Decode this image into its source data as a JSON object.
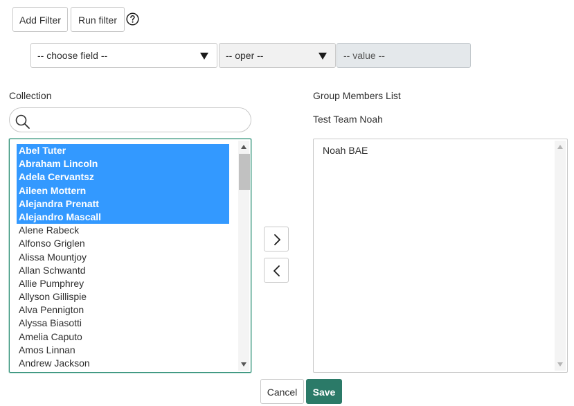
{
  "toolbar": {
    "add_filter_label": "Add Filter",
    "run_filter_label": "Run filter",
    "help_icon": "question-circle-icon"
  },
  "filter": {
    "field_value": "-- choose field --",
    "operator_value": "-- oper --",
    "value_placeholder": "-- value --"
  },
  "collection": {
    "label": "Collection",
    "search_placeholder": "",
    "search_icon": "magnifier-icon",
    "items": [
      {
        "name": "Abel Tuter",
        "selected": true
      },
      {
        "name": "Abraham Lincoln",
        "selected": true
      },
      {
        "name": "Adela Cervantsz",
        "selected": true
      },
      {
        "name": "Aileen Mottern",
        "selected": true
      },
      {
        "name": "Alejandra Prenatt",
        "selected": true
      },
      {
        "name": "Alejandro Mascall",
        "selected": true
      },
      {
        "name": "Alene Rabeck",
        "selected": false
      },
      {
        "name": "Alfonso Griglen",
        "selected": false
      },
      {
        "name": "Alissa Mountjoy",
        "selected": false
      },
      {
        "name": "Allan Schwantd",
        "selected": false
      },
      {
        "name": "Allie Pumphrey",
        "selected": false
      },
      {
        "name": "Allyson Gillispie",
        "selected": false
      },
      {
        "name": "Alva Pennigton",
        "selected": false
      },
      {
        "name": "Alyssa Biasotti",
        "selected": false
      },
      {
        "name": "Amelia Caputo",
        "selected": false
      },
      {
        "name": "Amos Linnan",
        "selected": false
      },
      {
        "name": "Andrew Jackson",
        "selected": false
      }
    ],
    "scroll_position": 0.0
  },
  "transfer": {
    "add_icon": "chevron-right-icon",
    "remove_icon": "chevron-left-icon"
  },
  "members": {
    "label": "Group Members List",
    "group_name": "Test Team Noah",
    "items": [
      "Noah BAE"
    ]
  },
  "footer": {
    "cancel_label": "Cancel",
    "save_label": "Save"
  },
  "colors": {
    "selection": "#3399ff",
    "save_button": "#2b7a68",
    "focus_border": "#2f8f77"
  }
}
